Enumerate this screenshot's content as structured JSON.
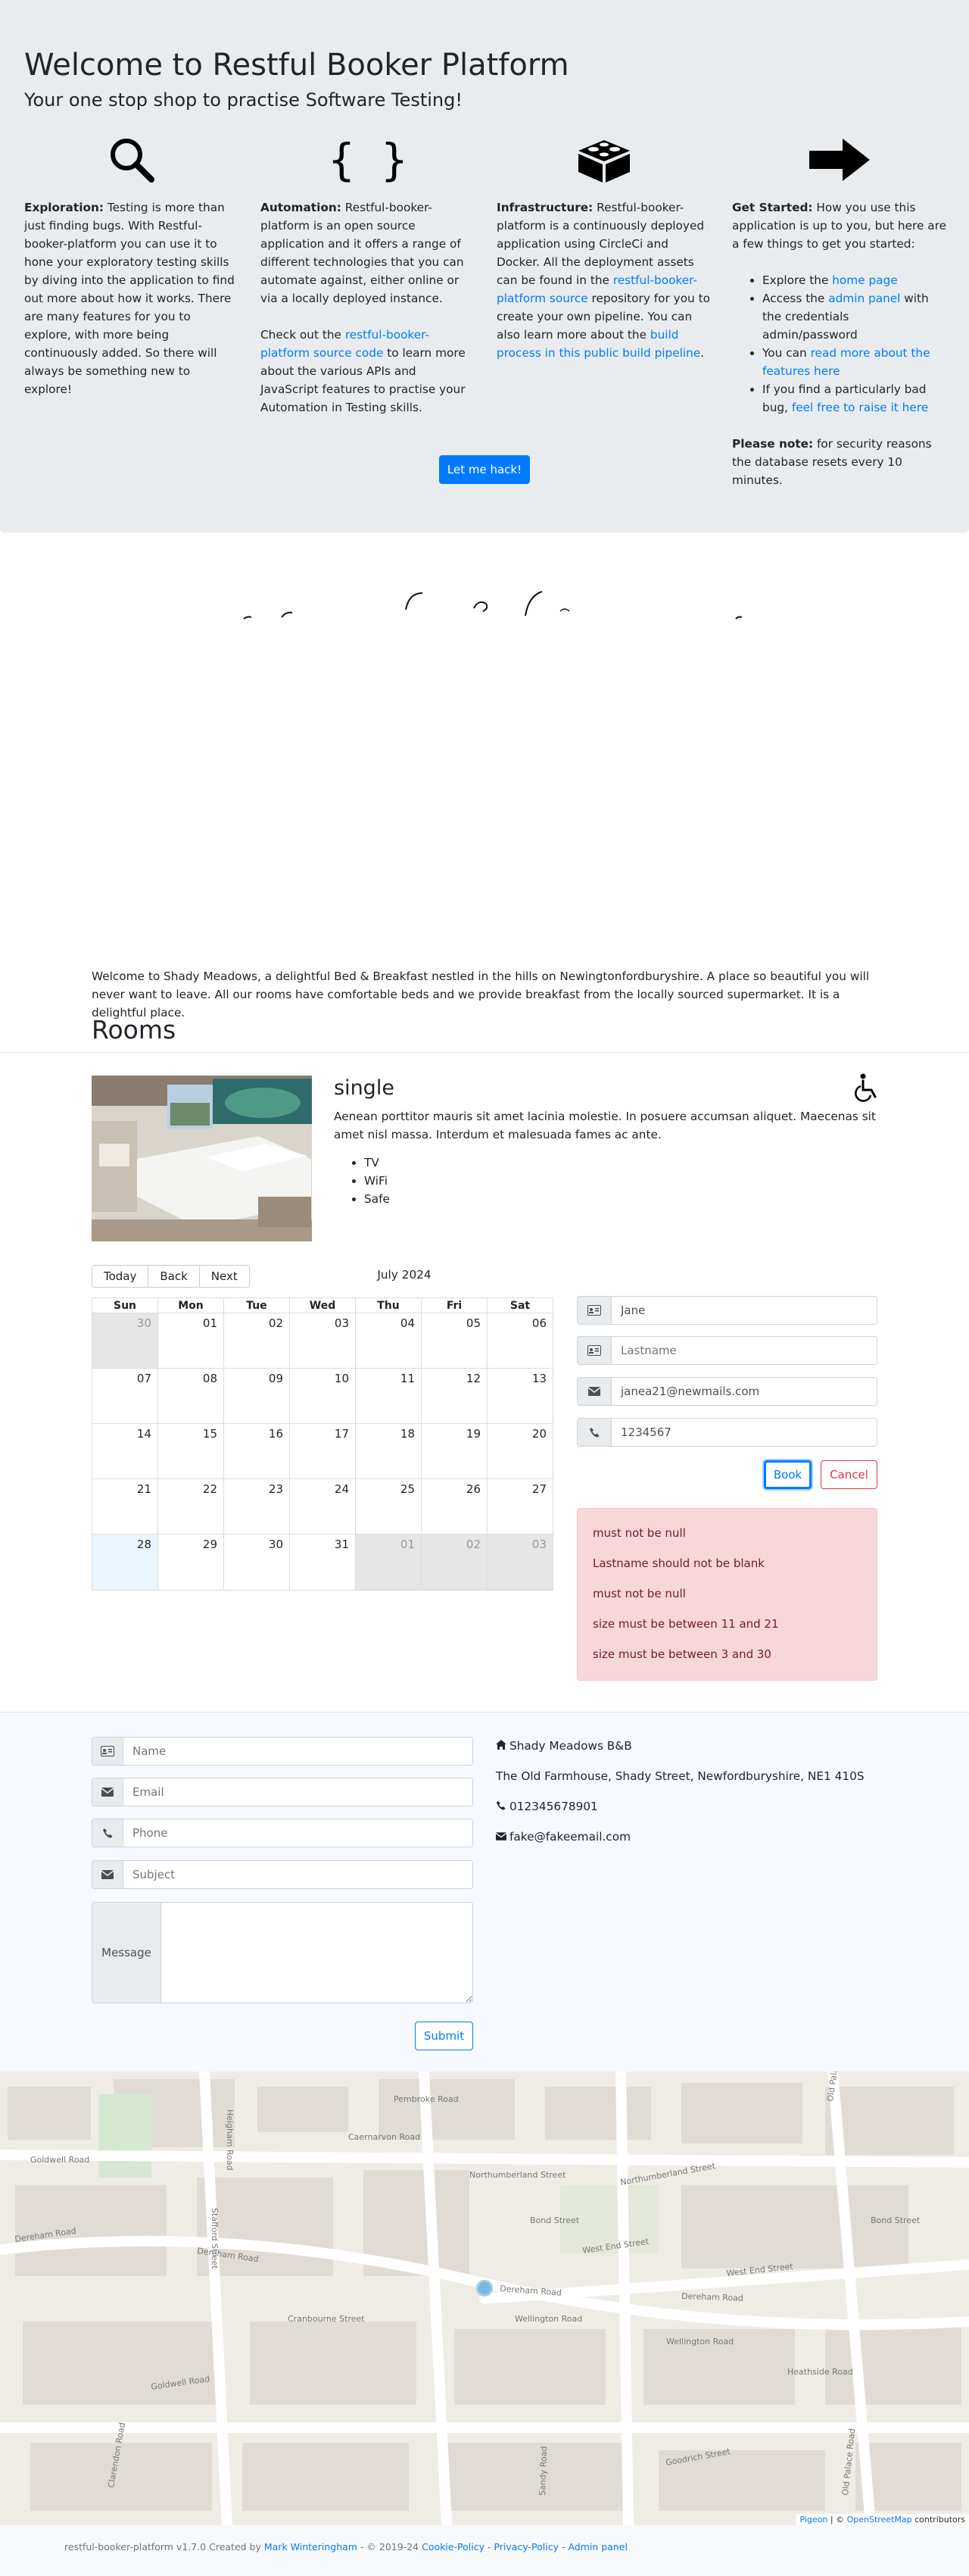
{
  "hero": {
    "title": "Welcome to Restful Booker Platform",
    "subtitle": "Your one stop shop to practise Software Testing!",
    "columns": [
      {
        "icon": "search-icon",
        "heading": "Exploration:",
        "text": "Testing is more than just finding bugs. With Restful-booker-platform you can use it to hone your exploratory testing skills by diving into the application to find out more about how it works. There are many features for you to explore, with more being continuously added. So there will always be something new to explore!"
      },
      {
        "icon": "code-braces-icon",
        "heading": "Automation:",
        "text": "Restful-booker-platform is an open source application and it offers a range of different technologies that you can automate against, either online or via a locally deployed instance.",
        "p2_before": "Check out the ",
        "p2_link": "restful-booker-platform source code",
        "p2_after": " to learn more about the various APIs and JavaScript features to practise your Automation in Testing skills."
      },
      {
        "icon": "cube-icon",
        "heading": "Infrastructure:",
        "text_before": "Restful-booker-platform is a continuously deployed application using CircleCi and Docker. All the deployment assets can be found in the ",
        "link1": "restful-booker-platform source",
        "text_mid": " repository for you to create your own pipeline. You can also learn more about the ",
        "link2": "build process in this public build pipeline",
        "text_after": "."
      },
      {
        "icon": "arrow-right-icon",
        "heading": "Get Started:",
        "text": "How you use this application is up to you, but here are a few things to get you started:",
        "li1_before": "Explore the ",
        "li1_link": "home page",
        "li2_before": "Access the ",
        "li2_link": "admin panel",
        "li2_after": " with the credentials admin/password",
        "li3_before": "You can ",
        "li3_link": "read more about the features here",
        "li4_before": "If you find a particularly bad bug, ",
        "li4_link": "feel free to raise it here",
        "note_heading": "Please note:",
        "note_text": " for security reasons the database resets every 10 minutes."
      }
    ],
    "button": "Let me hack!"
  },
  "hotel": {
    "description": "Welcome to Shady Meadows, a delightful Bed & Breakfast nestled in the hills on Newingtonfordburyshire. A place so beautiful you will never want to leave. All our rooms have comfortable beds and we provide breakfast from the locally sourced supermarket. It is a delightful place."
  },
  "rooms": {
    "title": "Rooms",
    "room": {
      "type": "single",
      "accessible_icon": "wheelchair-icon",
      "description": "Aenean porttitor mauris sit amet lacinia molestie. In posuere accumsan aliquet. Maecenas sit amet nisl massa. Interdum et malesuada fames ac ante.",
      "features": [
        "TV",
        "WiFi",
        "Safe"
      ]
    }
  },
  "calendar": {
    "buttons": {
      "today": "Today",
      "back": "Back",
      "next": "Next"
    },
    "label": "July 2024",
    "weekdays": [
      "Sun",
      "Mon",
      "Tue",
      "Wed",
      "Thu",
      "Fri",
      "Sat"
    ],
    "weeks": [
      [
        "30",
        "01",
        "02",
        "03",
        "04",
        "05",
        "06"
      ],
      [
        "07",
        "08",
        "09",
        "10",
        "11",
        "12",
        "13"
      ],
      [
        "14",
        "15",
        "16",
        "17",
        "18",
        "19",
        "20"
      ],
      [
        "21",
        "22",
        "23",
        "24",
        "25",
        "26",
        "27"
      ],
      [
        "28",
        "29",
        "30",
        "31",
        "01",
        "02",
        "03"
      ]
    ]
  },
  "booking": {
    "firstname": {
      "value": "Jane",
      "placeholder": "Firstname",
      "icon": "id-card-icon"
    },
    "lastname": {
      "value": "",
      "placeholder": "Lastname",
      "icon": "id-card-icon"
    },
    "email": {
      "value": "janea21@newmails.com",
      "placeholder": "Email",
      "icon": "envelope-icon"
    },
    "phone": {
      "value": "1234567",
      "placeholder": "Phone",
      "icon": "phone-icon"
    },
    "book": "Book",
    "cancel": "Cancel",
    "errors": [
      "must not be null",
      "Lastname should not be blank",
      "must not be null",
      "size must be between 11 and 21",
      "size must be between 3 and 30"
    ]
  },
  "contact_form": {
    "name_placeholder": "Name",
    "email_placeholder": "Email",
    "phone_placeholder": "Phone",
    "subject_placeholder": "Subject",
    "message_label": "Message",
    "submit": "Submit"
  },
  "contact_info": {
    "name": "Shady Meadows B&B",
    "address": "The Old Farmhouse, Shady Street, Newfordburyshire, NE1 410S",
    "phone": "012345678901",
    "email": "fake@fakeemail.com"
  },
  "map": {
    "streets": [
      "Dereham Road",
      "Dereham Road",
      "Dereham Road",
      "Dereham Road",
      "Old Palace Road",
      "Old Palace Road",
      "West End Street",
      "West End Street",
      "Bond Street",
      "Bond Street",
      "Northumberland Street",
      "Northumberland Street",
      "Caernarvon Road",
      "Heigham Road",
      "Wellington Road",
      "Wellington Road",
      "Clarendon Road",
      "Cranbourne Street",
      "Pembroke Road",
      "Stafford Street",
      "Sandy Road",
      "Goodrich Street",
      "Goldwell Road",
      "Goldwell Road",
      "Heathside Road"
    ],
    "attribution_link1": "Pigeon",
    "attribution_sep": " | © ",
    "attribution_link2": "OpenStreetMap",
    "attribution_after": " contributors"
  },
  "footer": {
    "text1": "restful-booker-platform v1.7.0 Created by ",
    "author": "Mark Winteringham",
    "text2": " - © 2019-24 ",
    "cookie": "Cookie-Policy",
    "sep1": " - ",
    "privacy": "Privacy-Policy",
    "sep2": " - ",
    "admin": "Admin panel"
  }
}
